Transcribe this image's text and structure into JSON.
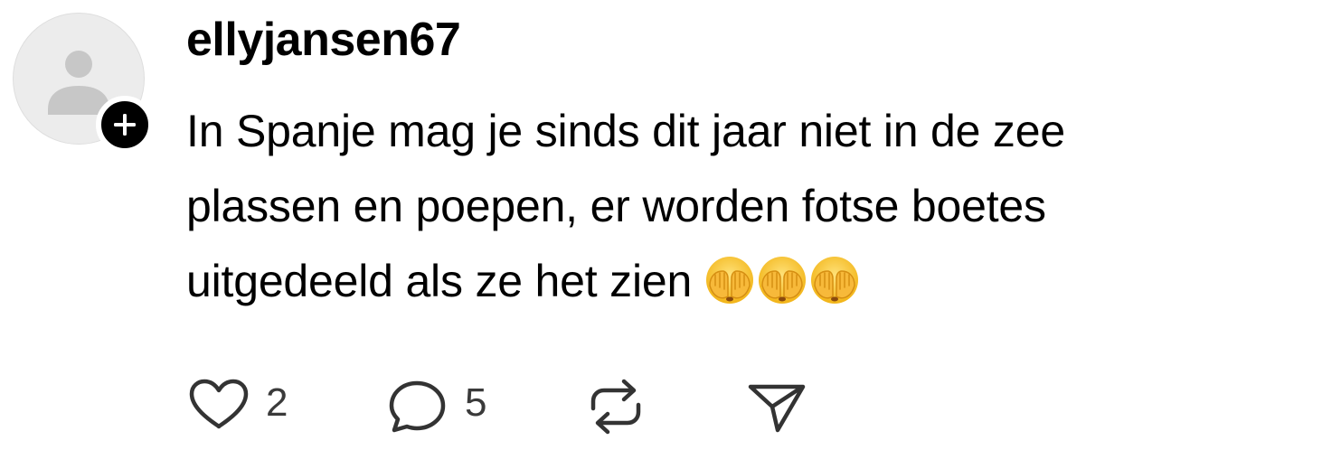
{
  "post": {
    "username": "ellyjansen67",
    "lines": [
      "In Spanje mag je sinds dit jaar niet in de zee",
      "plassen en poepen, er worden fotse boetes",
      "uitgedeeld als ze het zien"
    ],
    "emoji": [
      "face-with-hands-over-eyes",
      "face-with-hands-over-eyes",
      "face-with-hands-over-eyes"
    ]
  },
  "actions": {
    "like_count": "2",
    "reply_count": "5"
  },
  "colors": {
    "text": "#000000",
    "muted": "#3a3a3a",
    "avatar_bg": "#ececec",
    "avatar_figure": "#c7c7c7",
    "emoji_yellow": "#f7c12d"
  }
}
